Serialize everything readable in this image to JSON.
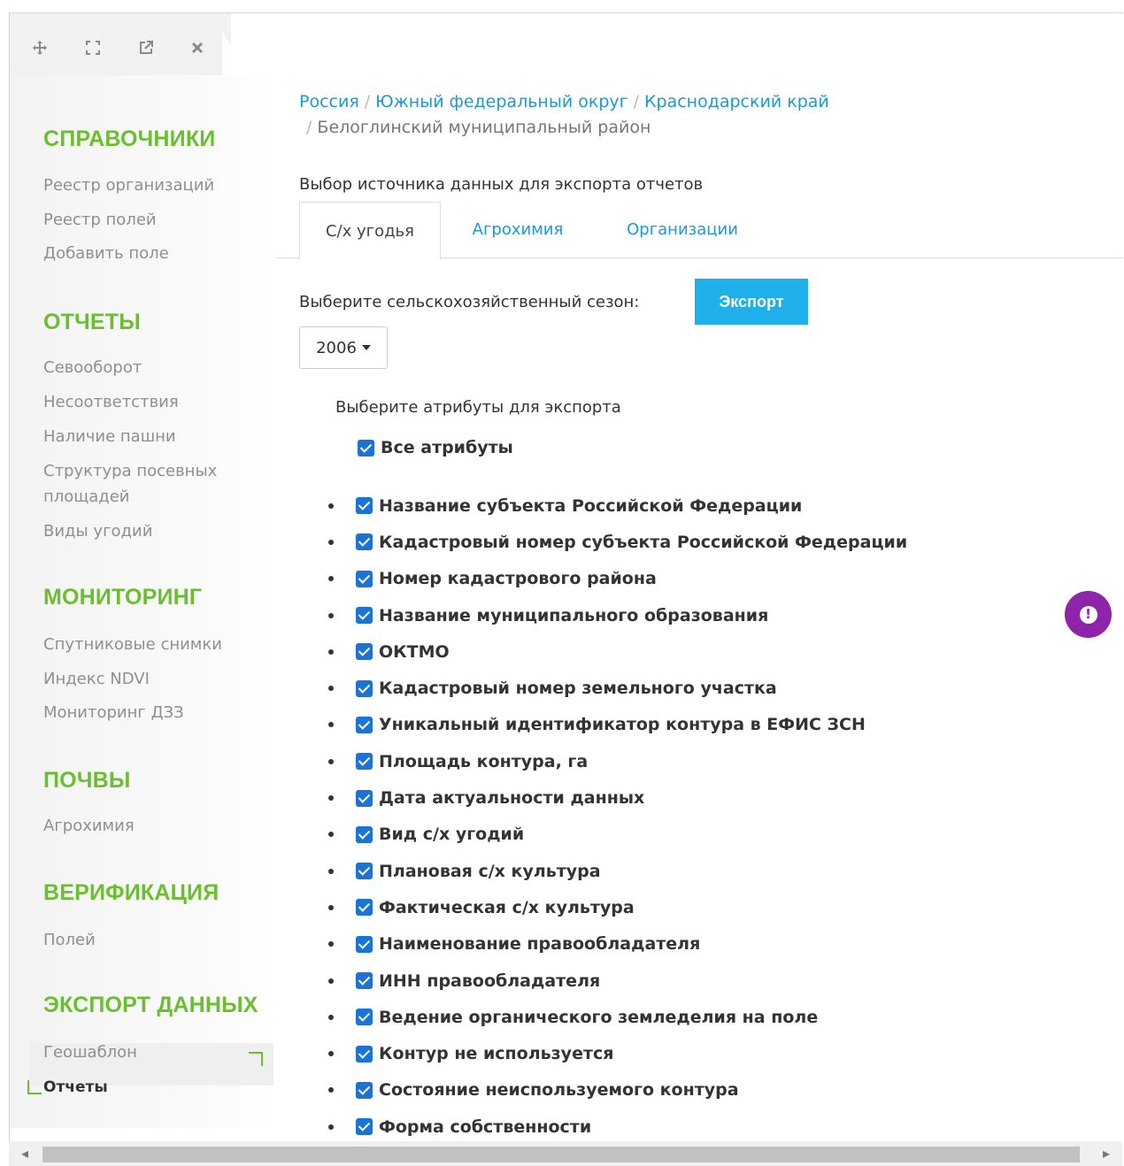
{
  "window": {
    "icons": [
      "move-icon",
      "expand-icon",
      "external-link-icon",
      "close-icon"
    ]
  },
  "sidebar": {
    "sections": [
      {
        "title": "СПРАВОЧНИКИ",
        "items": [
          "Реестр организаций",
          "Реестр полей",
          "Добавить поле"
        ]
      },
      {
        "title": "ОТЧЕТЫ",
        "items": [
          "Севооборот",
          "Несоответствия",
          "Наличие пашни",
          "Структура посевных",
          "площадей",
          "Виды угодий"
        ]
      },
      {
        "title": "МОНИТОРИНГ",
        "items": [
          "Спутниковые снимки",
          "Индекс NDVI",
          "Мониторинг ДЗЗ"
        ]
      },
      {
        "title": "ПОЧВЫ",
        "items": [
          "Агрохимия"
        ]
      },
      {
        "title": "ВЕРИФИКАЦИЯ",
        "items": [
          "Полей"
        ]
      },
      {
        "title": "ЭКСПОРТ ДАННЫХ",
        "items": [
          "Геошаблон",
          "Отчеты"
        ]
      }
    ],
    "active_item": "Отчеты"
  },
  "breadcrumb": {
    "links": [
      "Россия",
      "Южный федеральный округ",
      "Краснодарский край"
    ],
    "separator": "/",
    "current": "Белоглинский муниципальный район"
  },
  "main": {
    "source_title": "Выбор источника данных для экспорта отчетов",
    "tabs": [
      {
        "label": "С/х угодья",
        "active": true
      },
      {
        "label": "Агрохимия",
        "active": false
      },
      {
        "label": "Организации",
        "active": false
      }
    ],
    "season_label": "Выберите сельскохозяйственный сезон:",
    "export_button": "Экспорт",
    "season_value": "2006",
    "attributes_title": "Выберите атрибуты для экспорта",
    "all_attributes_label": "Все атрибуты",
    "all_attributes_checked": true,
    "attributes": [
      "Название субъекта Российской Федерации",
      "Кадастровый номер субъекта Российской Федерации",
      "Номер кадастрового района",
      "Название муниципального образования",
      "ОКТМО",
      "Кадастровый номер земельного участка",
      "Уникальный идентификатор контура в ЕФИС ЗСН",
      "Площадь контура, га",
      "Дата актуальности данных",
      "Вид с/х угодий",
      "Плановая с/х культура",
      "Фактическая с/х культура",
      "Наименование правообладателя",
      "ИНН правообладателя",
      "Ведение органического земледелия на поле",
      "Контур не используется",
      "Состояние неиспользуемого контура",
      "Форма собственности"
    ]
  },
  "colors": {
    "section_title": "#6abf2e",
    "link": "#1a9ad6",
    "export_button": "#1fb0ec",
    "checkbox": "#1b73d6",
    "fab": "#8e24aa"
  },
  "fab": {
    "icon": "alert-icon",
    "glyph": "!"
  }
}
